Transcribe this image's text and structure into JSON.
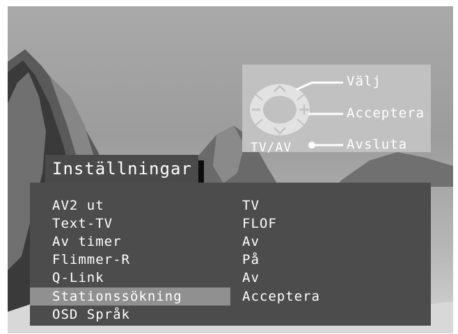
{
  "help": {
    "select_label": "Välj",
    "accept_label": "Acceptera",
    "exit_label": "Avsluta",
    "tvav_label": "TV/AV"
  },
  "menu": {
    "title": "Inställningar",
    "items": [
      {
        "label": "AV2 ut",
        "value": "TV"
      },
      {
        "label": "Text-TV",
        "value": "FLOF"
      },
      {
        "label": "Av timer",
        "value": "Av"
      },
      {
        "label": "Flimmer-R",
        "value": "På"
      },
      {
        "label": "Q-Link",
        "value": "Av"
      },
      {
        "label": "Stationssökning",
        "value": "Acceptera",
        "selected": true
      },
      {
        "label": "OSD Språk",
        "value": ""
      }
    ]
  },
  "colors": {
    "menu_bg": "#4c4c4c",
    "title_bg": "#4a4a4a",
    "selection": "#909090",
    "help_bg": "#c1c1c1",
    "text": "#ffffff"
  }
}
